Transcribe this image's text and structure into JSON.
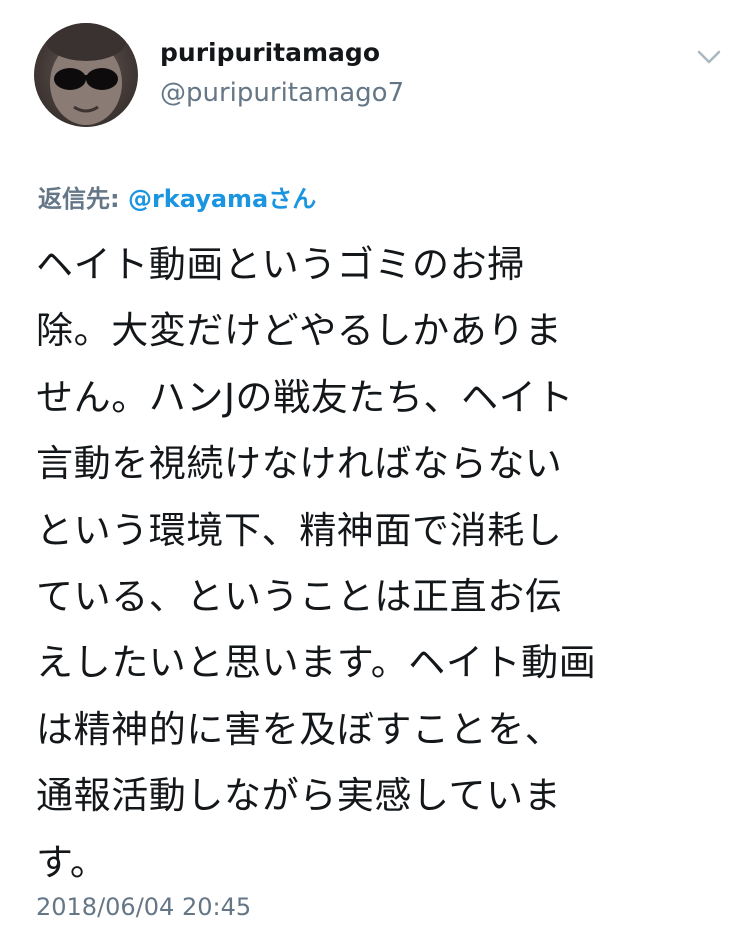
{
  "tweet": {
    "author": {
      "display_name": "puripuritamago",
      "handle": "@puripuritamago7"
    },
    "menu_icon": "chevron-down-icon",
    "reply": {
      "prefix": "返信先: ",
      "target": "@rkayamaさん"
    },
    "body_lines": [
      "ヘイト動画というゴミのお掃",
      "除。大変だけどやるしかありま",
      "せん。ハンJの戦友たち、ヘイト",
      "言動を視続けなければならない",
      "という環境下、精神面で消耗し",
      "ている、ということは正直お伝",
      "えしたいと思います。ヘイト動画",
      "は精神的に害を及ぼすことを、",
      "通報活動しながら実感していま",
      "す。"
    ],
    "timestamp": "2018/06/04 20:45"
  }
}
